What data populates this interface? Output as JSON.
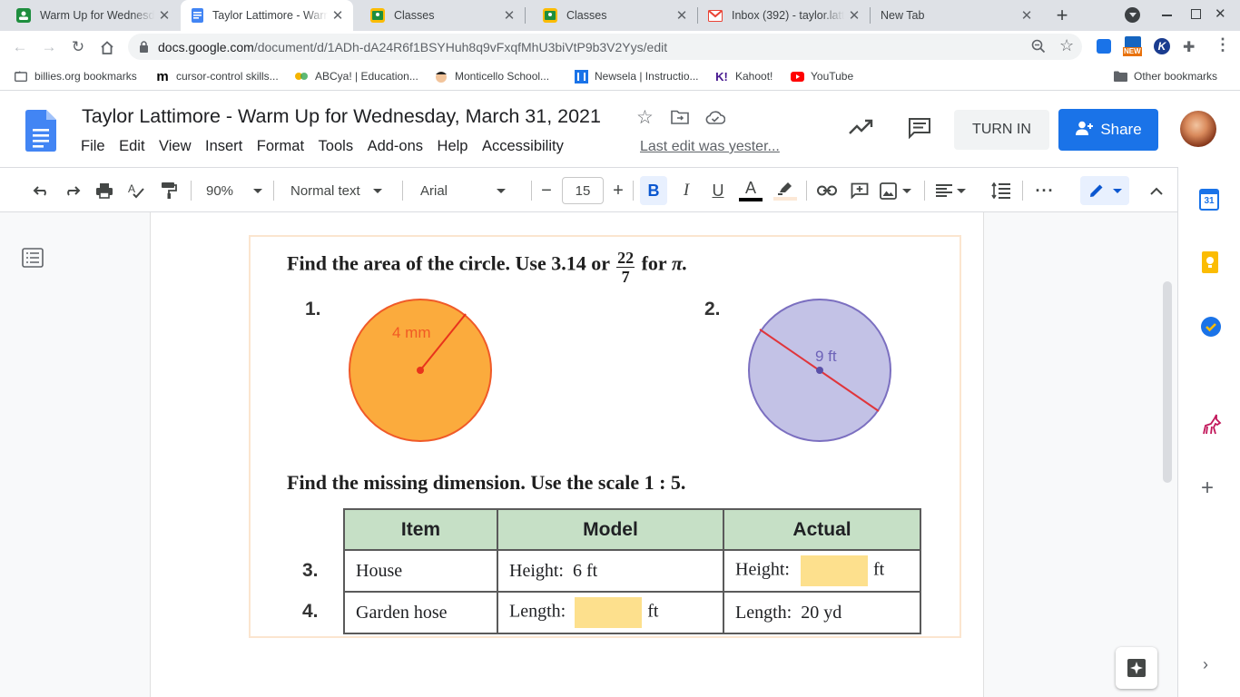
{
  "browser": {
    "tabs": [
      {
        "title": "Warm Up for Wednesday",
        "favicon": "classroom-icon",
        "active": false
      },
      {
        "title": "Taylor Lattimore - Warm Up",
        "favicon": "docs-icon",
        "active": true
      },
      {
        "title": "Classes",
        "favicon": "classroom-icon",
        "active": false
      },
      {
        "title": "Classes",
        "favicon": "classroom-icon",
        "active": false
      },
      {
        "title": "Inbox (392) - taylor.lattimore",
        "favicon": "gmail-icon",
        "active": false
      },
      {
        "title": "New Tab",
        "favicon": "",
        "active": false
      }
    ],
    "url_domain": "docs.google.com",
    "url_path": "/document/d/1ADh-dA24R6f1BSYHuh8q9vFxqfMhU3biVtP9b3V2Yys/edit",
    "extension_badge": "NEW",
    "bookmarks": [
      {
        "label": "billies.org bookmarks",
        "icon": "folder-icon"
      },
      {
        "label": "cursor-control skills...",
        "icon": "m-logo-icon"
      },
      {
        "label": "ABCya! | Education...",
        "icon": "abcya-icon"
      },
      {
        "label": "Monticello School...",
        "icon": "school-icon"
      },
      {
        "label": "Newsela | Instructio...",
        "icon": "newsela-icon"
      },
      {
        "label": "Kahoot!",
        "icon": "kahoot-icon"
      },
      {
        "label": "YouTube",
        "icon": "youtube-icon"
      }
    ],
    "other_bookmarks": "Other bookmarks"
  },
  "docs": {
    "title": "Taylor Lattimore - Warm Up for Wednesday, March 31, 2021",
    "menu": [
      "File",
      "Edit",
      "View",
      "Insert",
      "Format",
      "Tools",
      "Add-ons",
      "Help",
      "Accessibility"
    ],
    "last_edit": "Last edit was yester...",
    "turn_in": "TURN IN",
    "share": "Share",
    "toolbar": {
      "zoom": "90%",
      "style": "Normal text",
      "font": "Arial",
      "font_size": "15",
      "bold": "B",
      "italic": "I",
      "underline": "U",
      "text_color_letter": "A"
    },
    "side_panel": {
      "calendar_day": "31"
    },
    "colors": {
      "accent": "#1a73e8",
      "bold_active_bg": "#e8f0fe"
    }
  },
  "worksheet": {
    "heading1_a": "Find the area of the circle. Use 3.14 or",
    "fraction_num": "22",
    "fraction_den": "7",
    "heading1_b": "for",
    "pi": "π.",
    "problem1_num": "1.",
    "problem1_label": "4 mm",
    "problem2_num": "2.",
    "problem2_label": "9 ft",
    "heading2": "Find the missing dimension. Use the scale 1 : 5.",
    "table": {
      "headers": [
        "Item",
        "Model",
        "Actual"
      ],
      "rows": [
        {
          "num": "3.",
          "item": "House",
          "model_label": "Height:",
          "model_value": "6 ft",
          "actual_label": "Height:",
          "actual_unit": "ft"
        },
        {
          "num": "4.",
          "item": "Garden hose",
          "model_label": "Length:",
          "model_unit": "ft",
          "actual_label": "Length:",
          "actual_value": "20 yd"
        }
      ]
    },
    "colors": {
      "circle1": "#fbab3d",
      "circle2": "#c3c2e6",
      "header_bg": "#c6e0c6",
      "blank": "#fde08d"
    }
  }
}
